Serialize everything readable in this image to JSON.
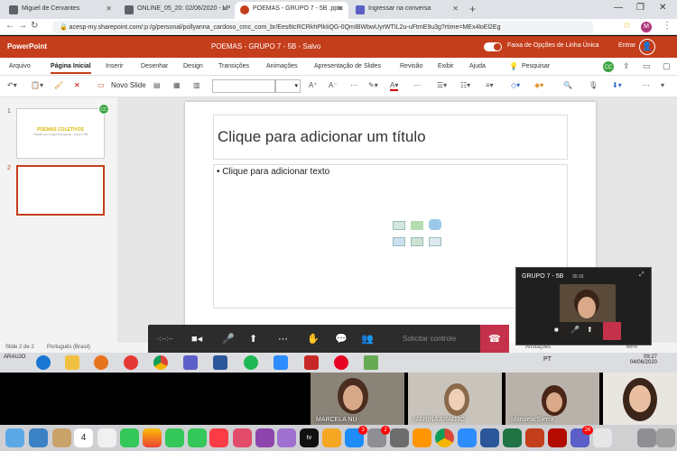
{
  "browser": {
    "tabs": [
      {
        "label": "Miguel de Cervantes",
        "color": "#5f6368"
      },
      {
        "label": "ONLINE_05_20: 02/06/2020 - LP",
        "color": "#5f6368"
      },
      {
        "label": "POEMAS - GRUPO 7 - 5B .pptx",
        "color": "#c43e1c"
      },
      {
        "label": "Ingressar na conversa",
        "color": "#5b5fc7"
      }
    ],
    "url": "acesp-my.sharepoint.com/:p:/g/personal/pollyanna_cardoso_cmc_com_br/Ees6tcRCRkhPlkIiQG-0QmIBWbwUyrWTIL2u-uFtmE9u3g?rtime=MEx4loEl2Eg",
    "profile_initial": "M"
  },
  "ppt": {
    "app_name": "PowerPoint",
    "doc_title": "POEMAS - GRUPO 7 - 5B  -  Salvo",
    "toggle_label": "Faixa de Opções de Linha Única",
    "signin": "Entrar",
    "ribbon_tabs": [
      "Arquivo",
      "Página Inicial",
      "Inserir",
      "Desenhar",
      "Design",
      "Transições",
      "Animações",
      "Apresentação de Slides",
      "Revisão",
      "Exibir",
      "Ajuda"
    ],
    "search_label": "Pesquisar",
    "new_slide": "Novo Slide",
    "coauthor": "CC",
    "thumbs": [
      {
        "num": "1",
        "title": "POEMAS COLETIVOS",
        "sub": "Trabalho de Língua Portuguesa - Grupo 7 5B"
      },
      {
        "num": "2"
      }
    ],
    "slide_title": "Clique para adicionar um título",
    "slide_body": "• Clique para adicionar texto",
    "status_left": "Slide 2 de 2",
    "status_lang": "Português (Brasil)",
    "status_notes": "Anotações",
    "zoom": "66%"
  },
  "teams": {
    "time": "-:--:--",
    "request_control": "Solicitar controle",
    "pip_title": "GRUPO 7 - 5B",
    "pip_time": "30:16"
  },
  "taskbar": {
    "left_label": "ARAUJO",
    "lang": "PT",
    "clock_time": "09:27",
    "clock_date": "04/06/2020"
  },
  "participants": [
    "MARCELA NU",
    "MARINA ARAUJO",
    "Manuela Sierra",
    ""
  ],
  "dock": {
    "calendar_day": "4",
    "badges": [
      "3",
      "2",
      "26"
    ]
  }
}
